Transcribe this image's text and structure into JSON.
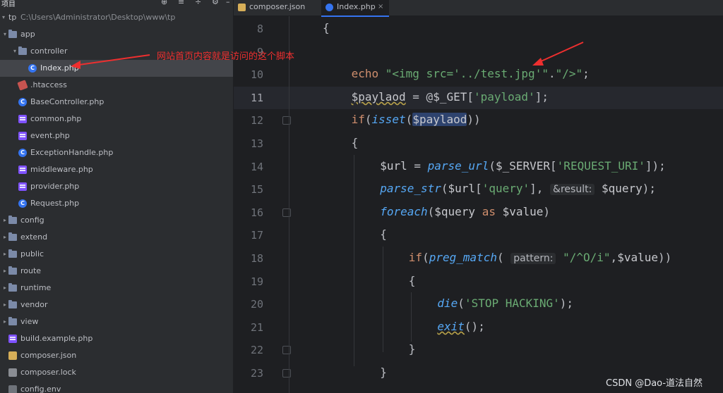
{
  "sidebar": {
    "title": "项目",
    "root": {
      "name": "tp",
      "path": "C:\\Users\\Administrator\\Desktop\\www\\tp"
    },
    "items": [
      {
        "label": "app",
        "kind": "folder",
        "depth": 0,
        "expanded": true
      },
      {
        "label": "controller",
        "kind": "folder",
        "depth": 1,
        "expanded": true
      },
      {
        "label": "Index.php",
        "kind": "php-class",
        "depth": 2,
        "selected": true
      },
      {
        "label": ".htaccess",
        "kind": "htaccess",
        "depth": 1
      },
      {
        "label": "BaseController.php",
        "kind": "php-class",
        "depth": 1
      },
      {
        "label": "common.php",
        "kind": "php-file",
        "depth": 1
      },
      {
        "label": "event.php",
        "kind": "php-file",
        "depth": 1
      },
      {
        "label": "ExceptionHandle.php",
        "kind": "php-class",
        "depth": 1
      },
      {
        "label": "middleware.php",
        "kind": "php-file",
        "depth": 1
      },
      {
        "label": "provider.php",
        "kind": "php-file",
        "depth": 1
      },
      {
        "label": "Request.php",
        "kind": "php-class",
        "depth": 1
      },
      {
        "label": "config",
        "kind": "folder",
        "depth": 0,
        "expanded": false
      },
      {
        "label": "extend",
        "kind": "folder",
        "depth": 0,
        "expanded": false
      },
      {
        "label": "public",
        "kind": "folder",
        "depth": 0,
        "expanded": false
      },
      {
        "label": "route",
        "kind": "folder",
        "depth": 0,
        "expanded": false
      },
      {
        "label": "runtime",
        "kind": "folder",
        "depth": 0,
        "expanded": false
      },
      {
        "label": "vendor",
        "kind": "folder",
        "depth": 0,
        "expanded": false
      },
      {
        "label": "view",
        "kind": "folder",
        "depth": 0,
        "expanded": false
      },
      {
        "label": "build.example.php",
        "kind": "php-file",
        "depth": 0
      },
      {
        "label": "composer.json",
        "kind": "json-file",
        "depth": 0
      },
      {
        "label": "composer.lock",
        "kind": "lock-file",
        "depth": 0
      },
      {
        "label": "config.env",
        "kind": "config-file",
        "depth": 0
      }
    ]
  },
  "tabs": [
    {
      "label": "composer.json",
      "active": false
    },
    {
      "label": "Index.php",
      "active": true
    }
  ],
  "editor": {
    "current_line": 11,
    "lines": [
      {
        "n": 8,
        "indent": 0,
        "tokens": [
          {
            "t": "{"
          }
        ]
      },
      {
        "n": 9,
        "indent": 1,
        "tokens": []
      },
      {
        "n": 10,
        "indent": 1,
        "tokens": [
          {
            "t": "echo",
            "c": "kw"
          },
          {
            "t": " "
          },
          {
            "t": "\"<img src='../test.jpg'\"",
            "c": "str"
          },
          {
            "t": "."
          },
          {
            "t": "\"/>\"",
            "c": "str"
          },
          {
            "t": ";"
          }
        ]
      },
      {
        "n": 11,
        "indent": 1,
        "tokens": [
          {
            "t": "$paylaod",
            "c": "var squiggle"
          },
          {
            "t": " = @"
          },
          {
            "t": "$_GET",
            "c": "var"
          },
          {
            "t": "["
          },
          {
            "t": "'payload'",
            "c": "str"
          },
          {
            "t": "];"
          }
        ]
      },
      {
        "n": 12,
        "indent": 1,
        "tokens": [
          {
            "t": "if",
            "c": "kw"
          },
          {
            "t": "("
          },
          {
            "t": "isset",
            "c": "fn"
          },
          {
            "t": "("
          },
          {
            "t": "$paylaod",
            "c": "var hl"
          },
          {
            "t": "))"
          }
        ]
      },
      {
        "n": 13,
        "indent": 1,
        "tokens": [
          {
            "t": "{"
          }
        ]
      },
      {
        "n": 14,
        "indent": 2,
        "tokens": [
          {
            "t": "$url",
            "c": "var"
          },
          {
            "t": " = "
          },
          {
            "t": "parse_url",
            "c": "fn"
          },
          {
            "t": "("
          },
          {
            "t": "$_SERVER",
            "c": "var"
          },
          {
            "t": "["
          },
          {
            "t": "'REQUEST_URI'",
            "c": "str"
          },
          {
            "t": "]);"
          }
        ]
      },
      {
        "n": 15,
        "indent": 2,
        "tokens": [
          {
            "t": "parse_str",
            "c": "fn"
          },
          {
            "t": "("
          },
          {
            "t": "$url",
            "c": "var"
          },
          {
            "t": "["
          },
          {
            "t": "'query'",
            "c": "str"
          },
          {
            "t": "], "
          },
          {
            "t": "&result:",
            "c": "hint"
          },
          {
            "t": " "
          },
          {
            "t": "$query",
            "c": "var"
          },
          {
            "t": ");"
          }
        ]
      },
      {
        "n": 16,
        "indent": 2,
        "tokens": [
          {
            "t": "foreach",
            "c": "fn"
          },
          {
            "t": "("
          },
          {
            "t": "$query",
            "c": "var"
          },
          {
            "t": " "
          },
          {
            "t": "as",
            "c": "kw"
          },
          {
            "t": " "
          },
          {
            "t": "$value",
            "c": "var"
          },
          {
            "t": ")"
          }
        ]
      },
      {
        "n": 17,
        "indent": 2,
        "tokens": [
          {
            "t": "{"
          }
        ]
      },
      {
        "n": 18,
        "indent": 3,
        "tokens": [
          {
            "t": "if",
            "c": "kw"
          },
          {
            "t": "("
          },
          {
            "t": "preg_match",
            "c": "fn"
          },
          {
            "t": "( "
          },
          {
            "t": "pattern:",
            "c": "hint"
          },
          {
            "t": " "
          },
          {
            "t": "\"/^O/i\"",
            "c": "str"
          },
          {
            "t": ","
          },
          {
            "t": "$value",
            "c": "var"
          },
          {
            "t": "))"
          }
        ]
      },
      {
        "n": 19,
        "indent": 3,
        "tokens": [
          {
            "t": "{"
          }
        ]
      },
      {
        "n": 20,
        "indent": 4,
        "tokens": [
          {
            "t": "die",
            "c": "fn"
          },
          {
            "t": "("
          },
          {
            "t": "'STOP HACKING'",
            "c": "str"
          },
          {
            "t": ");"
          }
        ]
      },
      {
        "n": 21,
        "indent": 4,
        "tokens": [
          {
            "t": "exit",
            "c": "fn squiggle"
          },
          {
            "t": "();"
          }
        ]
      },
      {
        "n": 22,
        "indent": 3,
        "tokens": [
          {
            "t": "}"
          }
        ]
      },
      {
        "n": 23,
        "indent": 2,
        "tokens": [
          {
            "t": "}"
          }
        ]
      }
    ]
  },
  "annotation": {
    "text": "网站首页内容就是访问的这个脚本",
    "color": "#ee2f2f"
  },
  "watermark": "CSDN @Dao-道法自然"
}
